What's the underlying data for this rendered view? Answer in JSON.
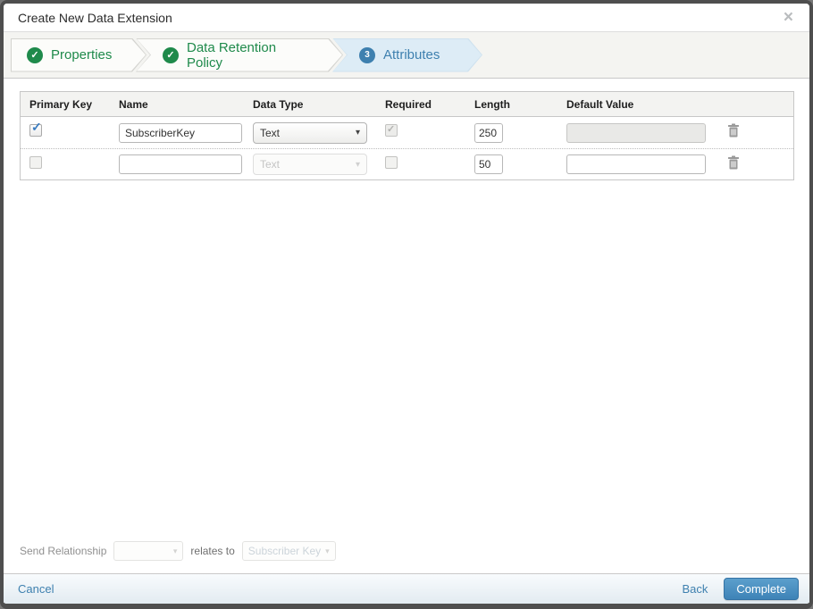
{
  "modal": {
    "title": "Create New Data Extension",
    "close_icon": "×"
  },
  "icons": {
    "check": "✓",
    "caret_down": "▾"
  },
  "wizard": {
    "steps": [
      {
        "label": "Properties",
        "status": "completed"
      },
      {
        "label": "Data Retention Policy",
        "status": "completed"
      },
      {
        "label": "Attributes",
        "status": "active",
        "number": "3"
      }
    ]
  },
  "table": {
    "headers": [
      "Primary Key",
      "Name",
      "Data Type",
      "Required",
      "Length",
      "Default Value"
    ],
    "rows": [
      {
        "primary_key_checked": true,
        "name": "SubscriberKey",
        "data_type": "Text",
        "data_type_disabled": false,
        "required_checked": true,
        "required_disabled": true,
        "length": "250",
        "default_value": "",
        "default_value_disabled": true
      },
      {
        "primary_key_checked": false,
        "name": "",
        "data_type": "Text",
        "data_type_disabled": true,
        "required_checked": false,
        "required_disabled": false,
        "length": "50",
        "default_value": "",
        "default_value_disabled": false
      }
    ]
  },
  "send_relationship": {
    "label": "Send Relationship",
    "relates_to_label": "relates to",
    "target_field": "Subscriber Key"
  },
  "footer": {
    "cancel_label": "Cancel",
    "back_label": "Back",
    "complete_label": "Complete"
  },
  "colors": {
    "success_green": "#1f8a4b",
    "accent_blue": "#3e80af",
    "active_step_bg": "#ddecf6",
    "button_blue": "#4792c6"
  }
}
